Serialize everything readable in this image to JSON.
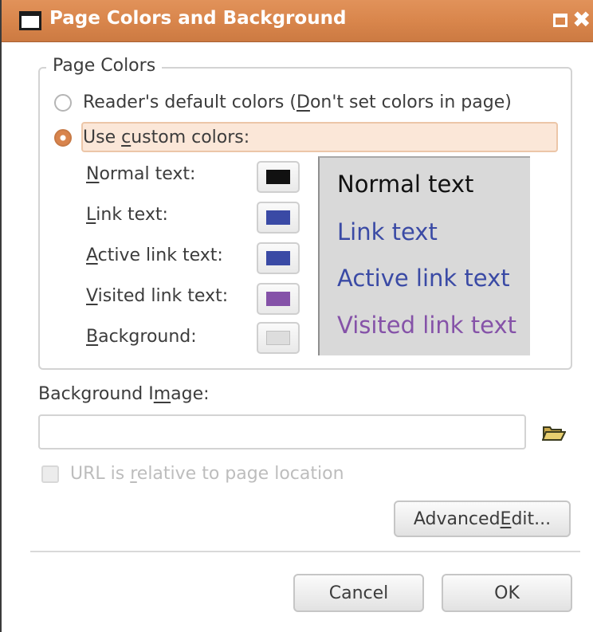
{
  "window": {
    "title": "Page Colors and Background"
  },
  "page_colors": {
    "legend": "Page Colors",
    "default_option": {
      "label_before": "Reader's default colors (",
      "mnemonic": "D",
      "label_after": "on't set colors in page)",
      "checked": false
    },
    "custom_option": {
      "label_before": "Use ",
      "mnemonic": "c",
      "label_after": "ustom colors:",
      "checked": true
    },
    "color_rows": [
      {
        "mnemonic": "N",
        "rest": "ormal text:",
        "color": "#111111"
      },
      {
        "mnemonic": "L",
        "rest": "ink text:",
        "color": "#3a4aa5"
      },
      {
        "mnemonic": "A",
        "rest": "ctive link text:",
        "color": "#3a4aa5"
      },
      {
        "mnemonic": "V",
        "rest": "isited link text:",
        "color": "#8552a8"
      },
      {
        "mnemonic": "B",
        "rest": "ackground:",
        "color": "#dddddd"
      }
    ]
  },
  "preview": {
    "background": "#d9d9d9",
    "normal": {
      "text": "Normal text",
      "color": "#111111"
    },
    "link": {
      "text": "Link text",
      "color": "#3a4aa5"
    },
    "active": {
      "text": "Active link text",
      "color": "#3a4aa5"
    },
    "visited": {
      "text": "Visited link text",
      "color": "#8552a8"
    }
  },
  "background_image": {
    "label_before": "Background I",
    "mnemonic": "m",
    "label_after": "age:",
    "value": "",
    "browse_icon": "folder-open-icon",
    "relative_checkbox": {
      "label_before": "URL is ",
      "mnemonic": "r",
      "label_after": "elative to page location",
      "checked": false,
      "disabled": true
    }
  },
  "buttons": {
    "advanced_before": "Advanced ",
    "advanced_mnemonic": "E",
    "advanced_after": "dit...",
    "cancel": "Cancel",
    "ok": "OK"
  },
  "title_icons": {
    "window": "window-icon",
    "maximize": "maximize-icon",
    "close": "close-icon"
  }
}
